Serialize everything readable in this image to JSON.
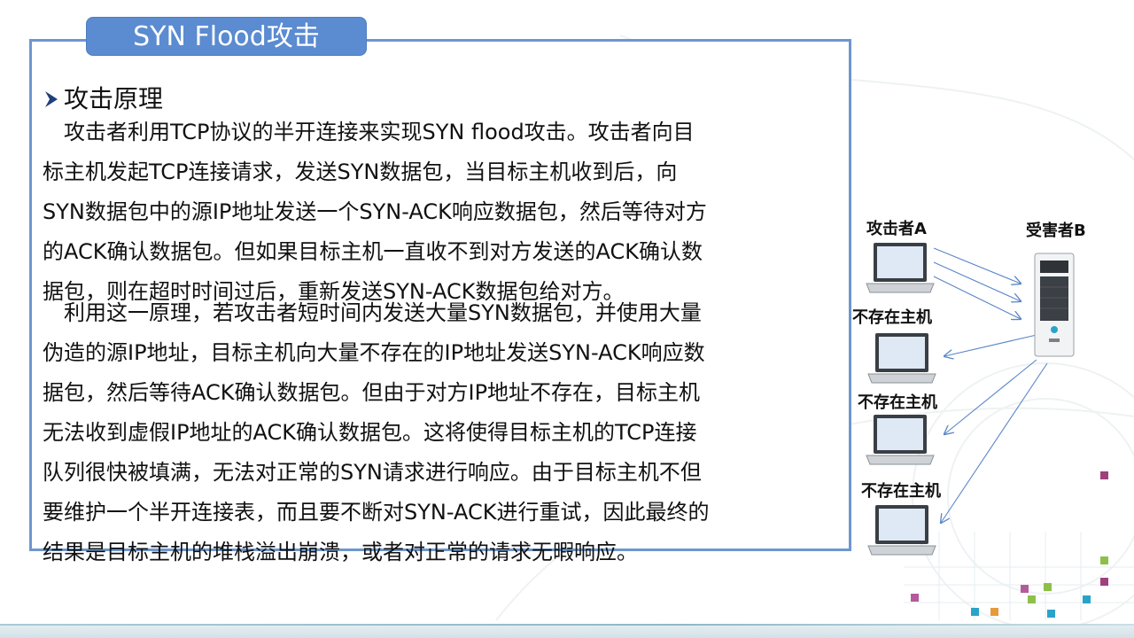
{
  "slide": {
    "title": "SYN Flood攻击",
    "section_heading": "攻击原理",
    "paragraph1": [
      "　攻击者利用TCP协议的半开连接来实现SYN  flood攻击。攻击者向目",
      "标主机发起TCP连接请求，发送SYN数据包，当目标主机收到后，向",
      "SYN数据包中的源IP地址发送一个SYN-ACK响应数据包，然后等待对方",
      "的ACK确认数据包。但如果目标主机一直收不到对方发送的ACK确认数",
      "据包，则在超时时间过后，重新发送SYN-ACK数据包给对方。"
    ],
    "paragraph2": [
      "　利用这一原理，若攻击者短时间内发送大量SYN数据包，并使用大量",
      "伪造的源IP地址，目标主机向大量不存在的IP地址发送SYN-ACK响应数",
      "据包，然后等待ACK确认数据包。但由于对方IP地址不存在，目标主机",
      "无法收到虚假IP地址的ACK确认数据包。这将使得目标主机的TCP连接",
      "队列很快被填满，无法对正常的SYN请求进行响应。由于目标主机不但",
      "要维护一个半开连接表，而且要不断对SYN-ACK进行重试，因此最终的",
      "结果是目标主机的堆栈溢出崩溃，或者对正常的请求无暇响应。"
    ]
  },
  "diagram": {
    "attacker_label": "攻击者A",
    "victim_label": "受害者B",
    "host1_label": "不存在主机",
    "host2_label": "不存在主机",
    "host3_label": "不存在主机"
  },
  "colors": {
    "accent_blue": "#5b8bd0",
    "border_blue": "#6d97cf",
    "arrow_blue": "#5a86c8"
  }
}
